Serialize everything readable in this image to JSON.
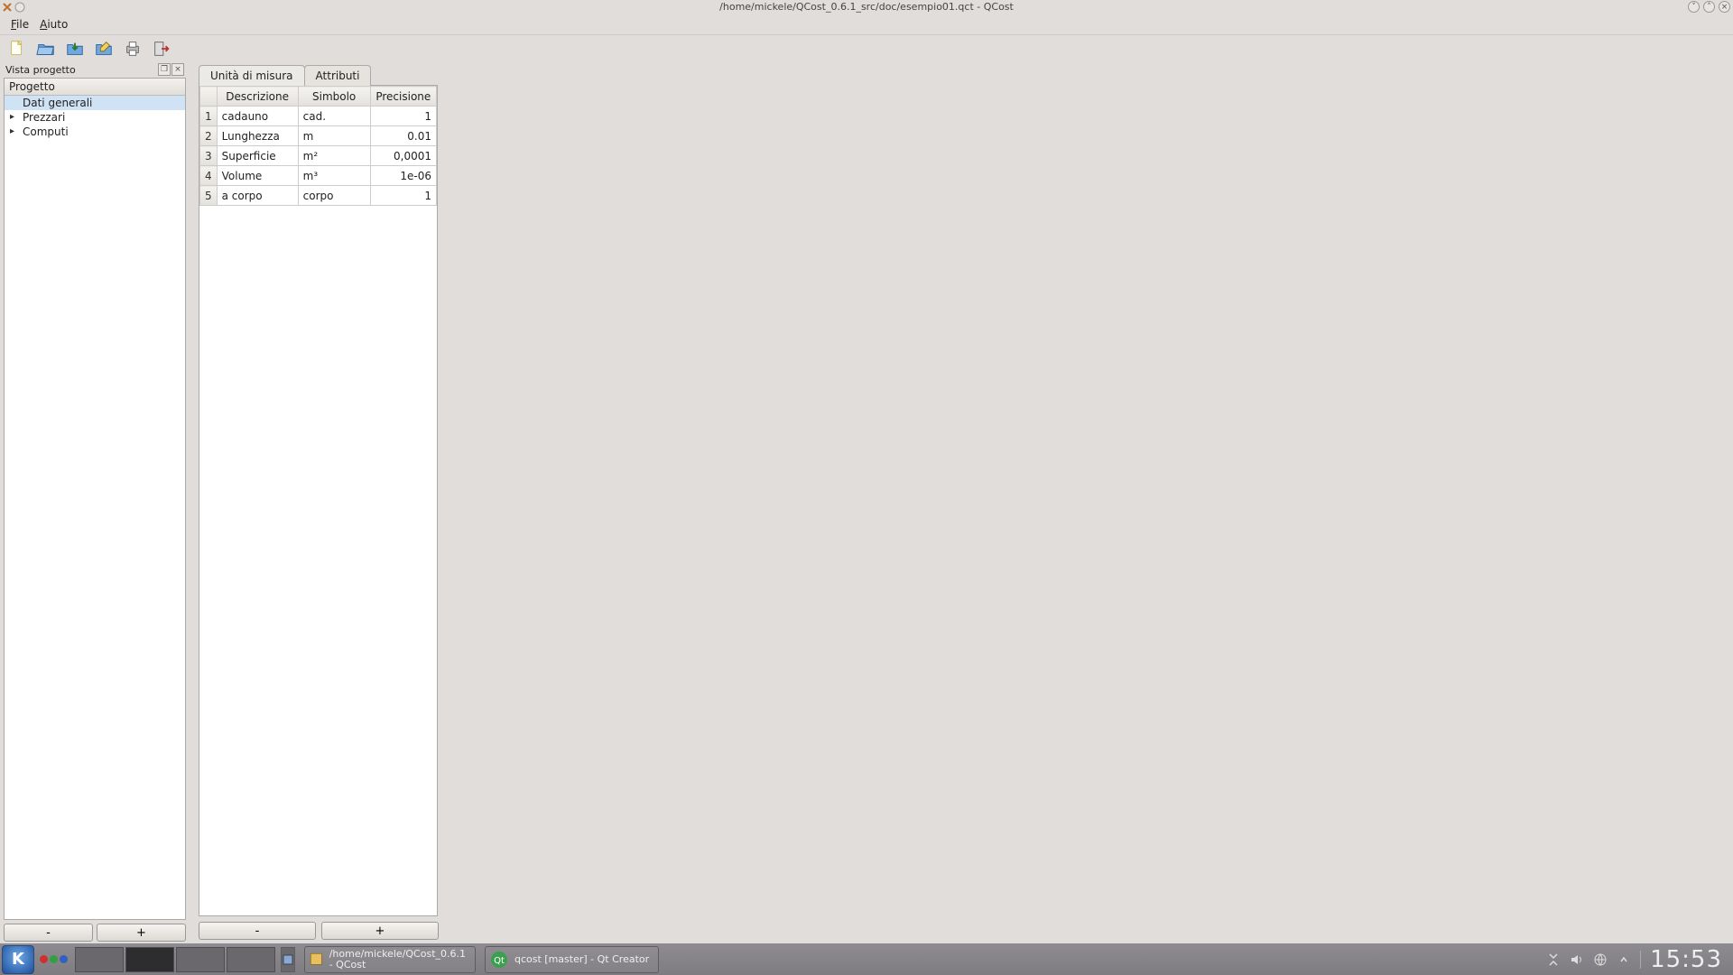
{
  "window": {
    "title": "/home/mickele/QCost_0.6.1_src/doc/esempio01.qct - QCost"
  },
  "menu": {
    "file_prefix": "F",
    "file_rest": "ile",
    "help_prefix": "A",
    "help_rest": "iuto"
  },
  "toolbar_icons": {
    "new": "new-file-icon",
    "open": "open-folder-icon",
    "save": "save-icon",
    "saveas": "save-as-icon",
    "print": "print-icon",
    "exit": "exit-icon"
  },
  "sidebar": {
    "dock_title": "Vista progetto",
    "tree_header": "Progetto",
    "items": [
      {
        "label": "Dati generali",
        "sel": true,
        "expandable": false
      },
      {
        "label": "Prezzari",
        "sel": false,
        "expandable": true
      },
      {
        "label": "Computi",
        "sel": false,
        "expandable": true
      }
    ],
    "btn_minus": "-",
    "btn_plus": "+"
  },
  "tabs": {
    "tab1": "Unità di misura",
    "tab2": "Attributi"
  },
  "table": {
    "headers": {
      "desc": "Descrizione",
      "simb": "Simbolo",
      "prec": "Precisione"
    },
    "rows": [
      {
        "n": "1",
        "desc": "cadauno",
        "simb": "cad.",
        "prec": "1"
      },
      {
        "n": "2",
        "desc": "Lunghezza",
        "simb": "m",
        "prec": "0.01"
      },
      {
        "n": "3",
        "desc": "Superficie",
        "simb": "m²",
        "prec": "0,0001"
      },
      {
        "n": "4",
        "desc": "Volume",
        "simb": "m³",
        "prec": "1e-06"
      },
      {
        "n": "5",
        "desc": "a corpo",
        "simb": "corpo",
        "prec": "1"
      }
    ],
    "btn_minus": "-",
    "btn_plus": "+"
  },
  "taskbar": {
    "k": "K",
    "task1_line1": "/home/mickele/QCost_0.6.1",
    "task1_line2": "- QCost",
    "task2": "qcost [master] - Qt Creator",
    "clock": "15:53"
  }
}
